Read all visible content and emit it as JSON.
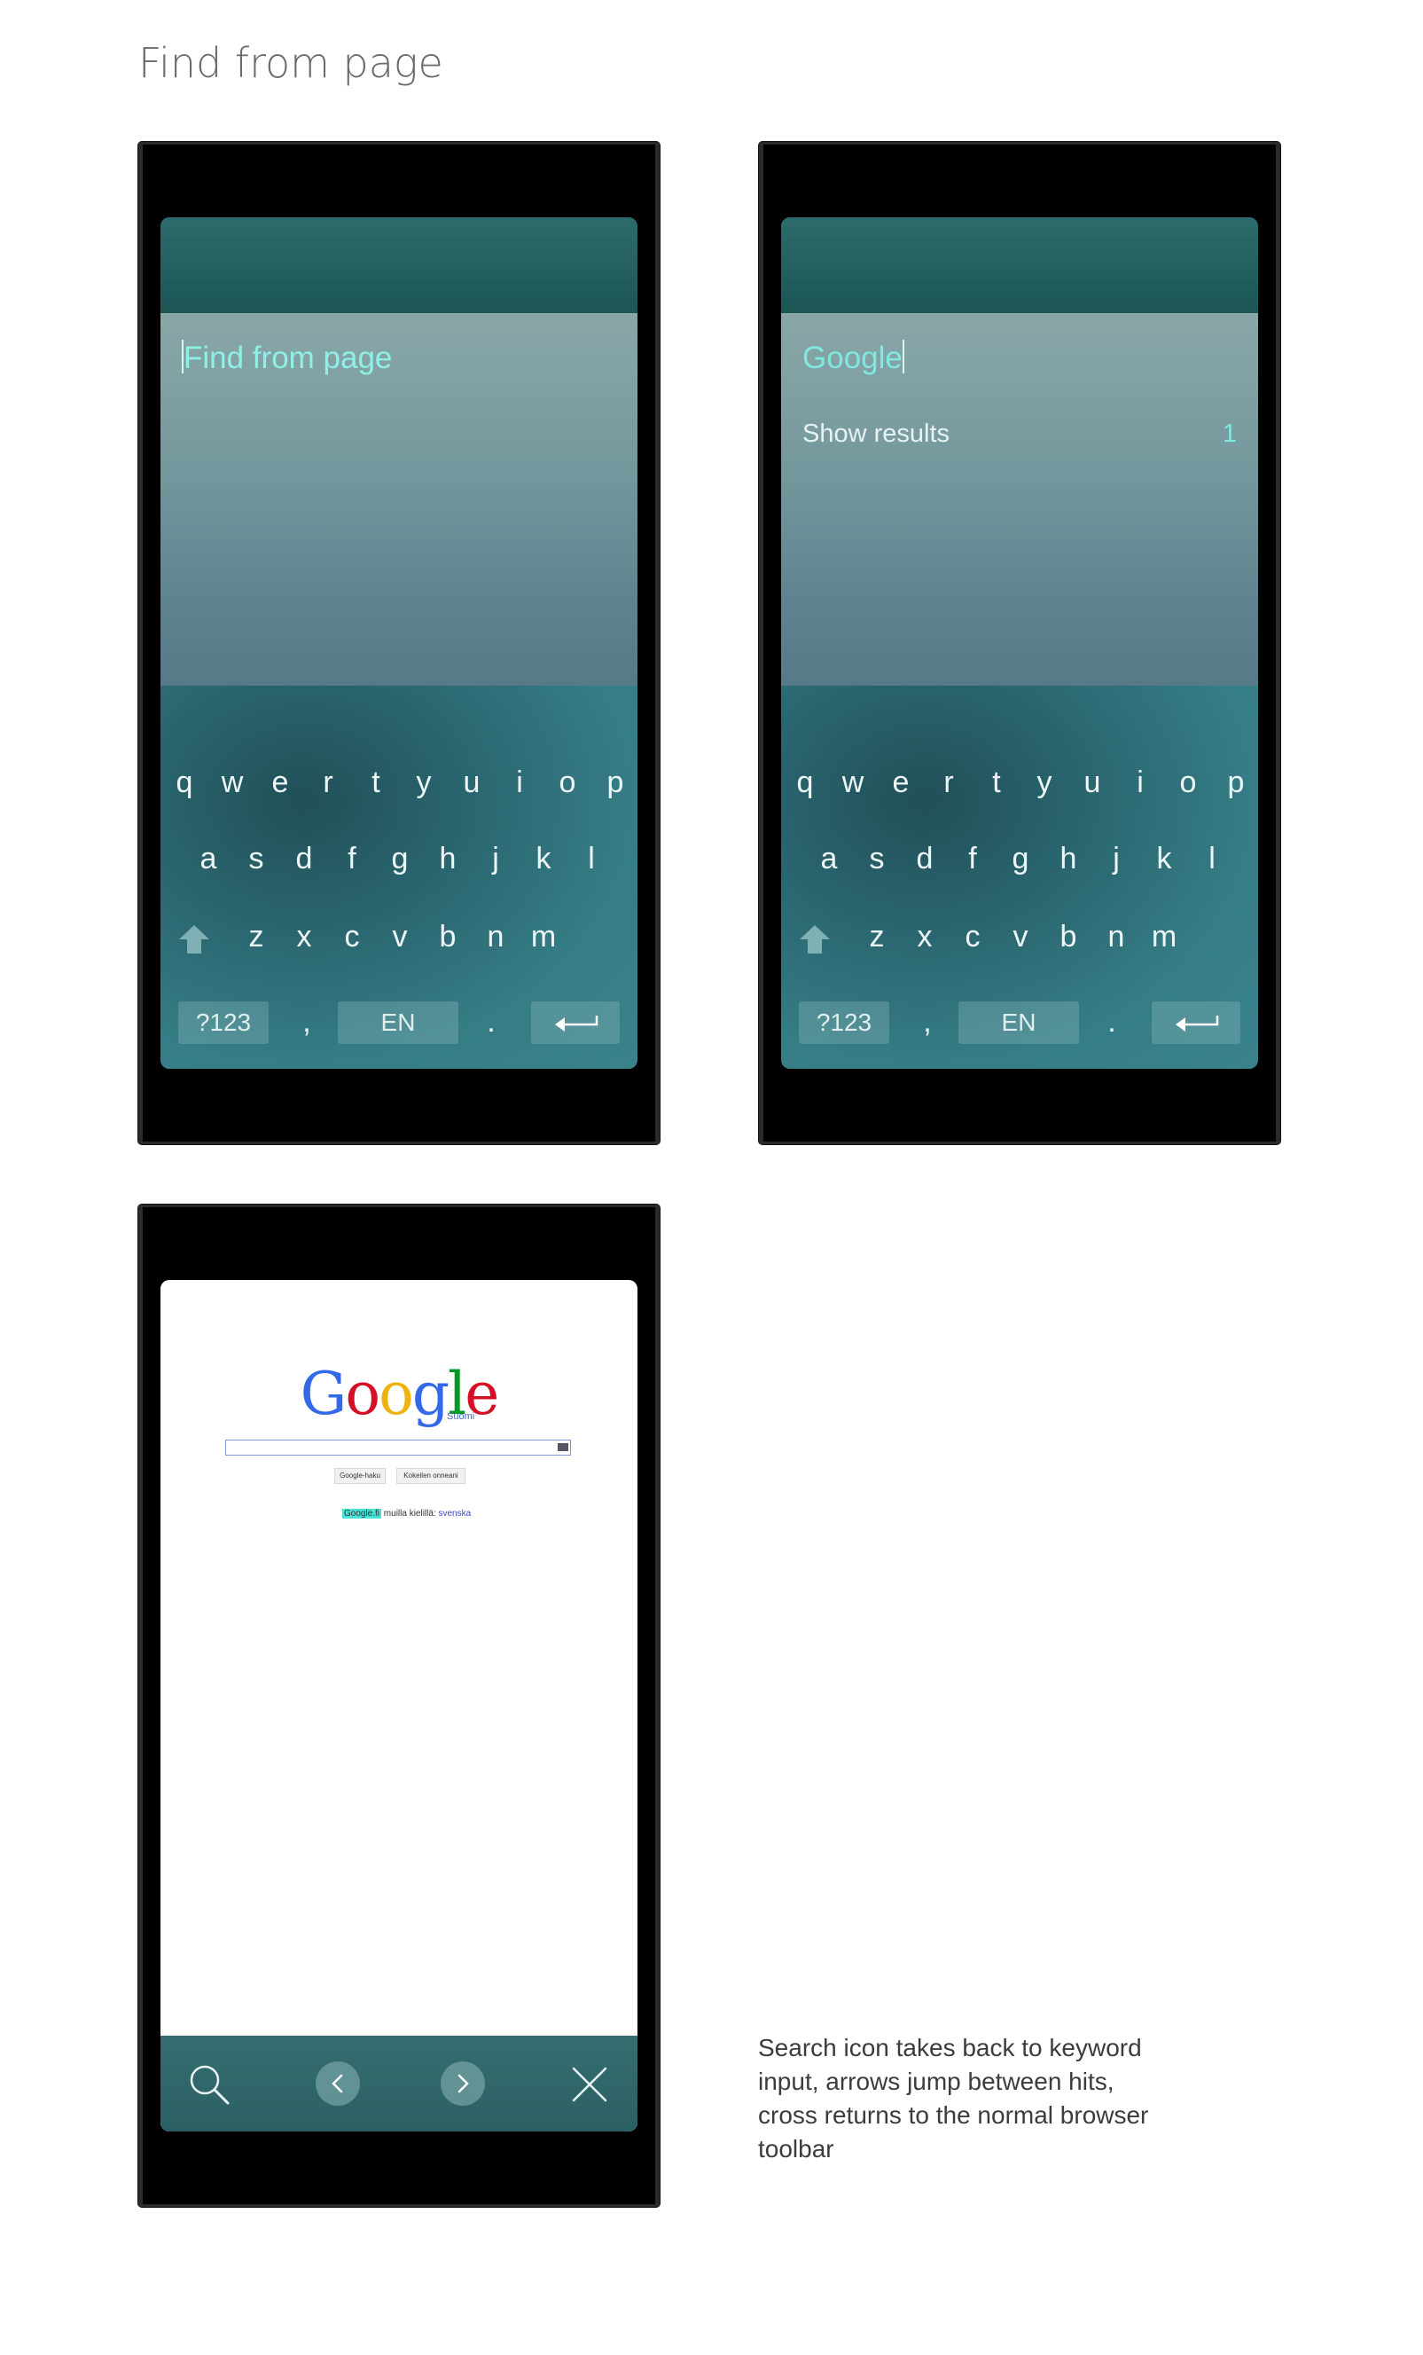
{
  "page_title": "Find from page",
  "keyboard": {
    "row1": [
      "q",
      "w",
      "e",
      "r",
      "t",
      "y",
      "u",
      "i",
      "o",
      "p"
    ],
    "row2": [
      "a",
      "s",
      "d",
      "f",
      "g",
      "h",
      "j",
      "k",
      "l"
    ],
    "row3": [
      "z",
      "x",
      "c",
      "v",
      "b",
      "n",
      "m"
    ],
    "symbols_label": "?123",
    "comma_label": ",",
    "language_label": "EN",
    "period_label": "."
  },
  "screen1": {
    "find_placeholder": "Find from page"
  },
  "screen2": {
    "find_value": "Google",
    "show_results_label": "Show results",
    "result_count": "1"
  },
  "screen3": {
    "google_logo": {
      "G": "G",
      "o1": "o",
      "o2": "o",
      "g": "g",
      "l": "l",
      "e": "e"
    },
    "google_sub": "Suomi",
    "button_search": "Google-haku",
    "button_lucky": "Kokeilen onneani",
    "lang_highlight": "Google.fi",
    "lang_text": " muilla kielillä:",
    "lang_link": "svenska",
    "toolbar_icons": [
      "search-icon",
      "chevron-left-icon",
      "chevron-right-icon",
      "close-icon"
    ]
  },
  "note_text": "Search icon takes back to keyword input, arrows jump between hits, cross returns to the normal browser toolbar",
  "colors": {
    "accent": "#7fe8e0",
    "highlight": "#46e3d7",
    "google_blue": "#3369e8",
    "google_red": "#d50f25",
    "google_yellow": "#eeb211",
    "google_green": "#009925"
  }
}
